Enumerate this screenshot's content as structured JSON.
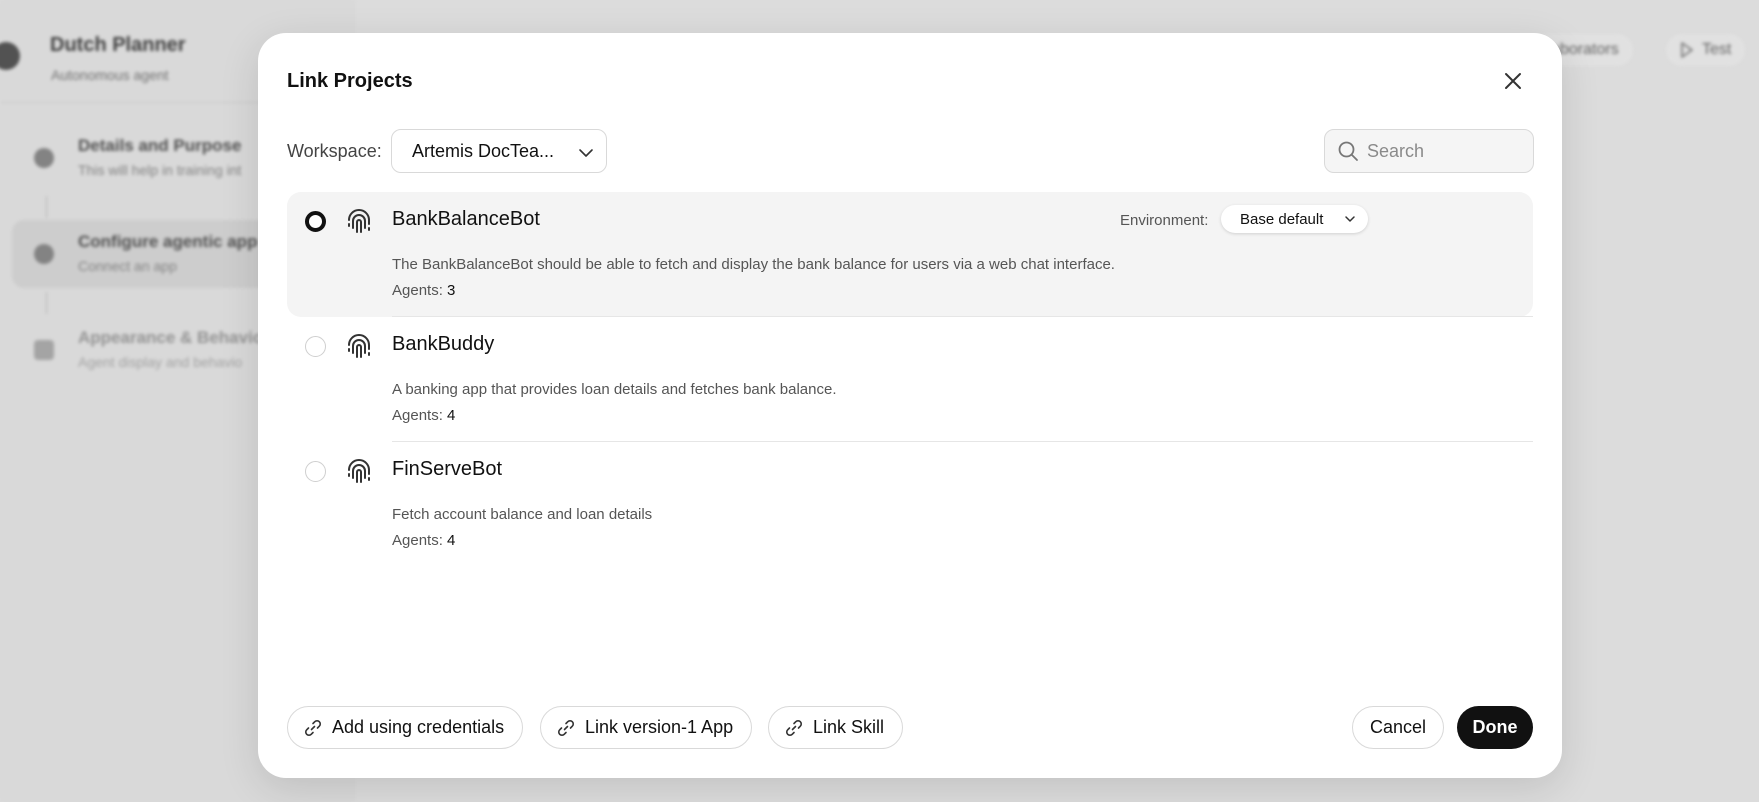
{
  "background": {
    "app_title": "Dutch Planner",
    "app_subtitle": "Autonomous agent",
    "steps": [
      {
        "title": "Details and Purpose",
        "subtitle": "This will help in training int"
      },
      {
        "title": "Configure agentic app",
        "subtitle": "Connect an app"
      },
      {
        "title": "Appearance & Behavior",
        "subtitle": "Agent display and behavio"
      }
    ],
    "collaborators_label": "llaborators",
    "test_label": "Test"
  },
  "modal": {
    "title": "Link Projects",
    "workspace_label": "Workspace:",
    "workspace_value": "Artemis DocTea...",
    "search_placeholder": "Search",
    "environment_label": "Environment:",
    "environment_value": "Base default",
    "agents_label": "Agents:",
    "projects": [
      {
        "name": "BankBalanceBot",
        "description": "The BankBalanceBot should be able to fetch and display the bank balance for users via a web chat interface.",
        "agents": "3",
        "selected": true
      },
      {
        "name": "BankBuddy",
        "description": "A banking app that provides loan details and fetches bank balance.",
        "agents": "4",
        "selected": false
      },
      {
        "name": "FinServeBot",
        "description": "Fetch account balance and loan details",
        "agents": "4",
        "selected": false
      }
    ],
    "footer": {
      "add_credentials": "Add using credentials",
      "link_v1": "Link version-1 App",
      "link_skill": "Link Skill",
      "cancel": "Cancel",
      "done": "Done"
    }
  }
}
